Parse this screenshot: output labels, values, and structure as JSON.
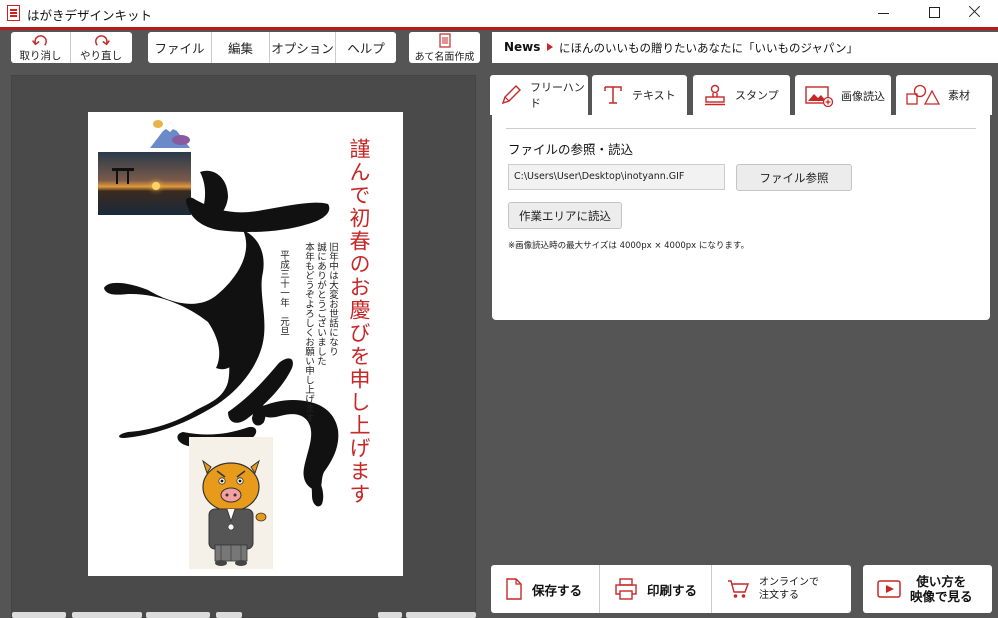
{
  "window": {
    "title": "はがきデザインキット"
  },
  "toolbar": {
    "undo_label": "取り消し",
    "redo_label": "やり直し",
    "menu": [
      "ファイル",
      "編集",
      "オプション",
      "ヘルプ"
    ],
    "address_label": "あて名面作成"
  },
  "news": {
    "label": "News",
    "text": "にほんのいいもの贈りたいあなたに「いいものジャパン」"
  },
  "card": {
    "greeting": "謹んで初春のお慶びを申し上げます",
    "message_lines": [
      "旧年中は大変お世話になり",
      "誠にありがとうございました",
      "本年もどうぞよろしくお願い申し上げます"
    ],
    "date": "平成三十一年　元旦"
  },
  "tabs": [
    {
      "label": "フリーハンド",
      "icon": "pencil-icon"
    },
    {
      "label": "テキスト",
      "icon": "text-t-icon"
    },
    {
      "label": "スタンプ",
      "icon": "stamp-icon"
    },
    {
      "label": "画像読込",
      "icon": "image-add-icon",
      "active": true
    },
    {
      "label": "素材",
      "icon": "shapes-icon"
    }
  ],
  "panel": {
    "section_title": "ファイルの参照・読込",
    "file_path": "C:\\Users\\User\\Desktop\\inotyann.GIF",
    "browse_label": "ファイル参照",
    "load_label": "作業エリアに読込",
    "note": "※画像読込時の最大サイズは 4000px × 4000px になります。"
  },
  "actions": {
    "save_label": "保存する",
    "print_label": "印刷する",
    "order_line1": "オンラインで",
    "order_line2": "注文する",
    "video_line1": "使い方を",
    "video_line2": "映像で見る"
  },
  "colors": {
    "accent": "#b71c1c",
    "greeting_red": "#c62828",
    "workspace": "#555555"
  }
}
